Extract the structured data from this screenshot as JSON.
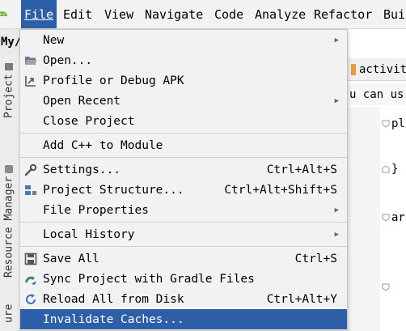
{
  "menubar": {
    "items": [
      {
        "label": "File"
      },
      {
        "label": "Edit"
      },
      {
        "label": "View"
      },
      {
        "label": "Navigate"
      },
      {
        "label": "Code"
      },
      {
        "label": "Analyze"
      },
      {
        "label": "Refactor"
      },
      {
        "label": "Bui"
      }
    ]
  },
  "project_label": "My/",
  "left_tabs": {
    "project": "Project",
    "resource_manager": "Resource Manager",
    "structure": "ure"
  },
  "editor": {
    "tab_label": "activity",
    "info_text": "u can us",
    "lines": [
      "pl",
      "}",
      "ar"
    ]
  },
  "file_menu": {
    "new": "New",
    "open": "Open...",
    "profile_debug": "Profile or Debug APK",
    "open_recent": "Open Recent",
    "close_project": "Close Project",
    "add_cpp": "Add C++ to Module",
    "settings": "Settings...",
    "settings_shortcut": "Ctrl+Alt+S",
    "project_structure": "Project Structure...",
    "project_structure_shortcut": "Ctrl+Alt+Shift+S",
    "file_properties": "File Properties",
    "local_history": "Local History",
    "save_all": "Save All",
    "save_all_shortcut": "Ctrl+S",
    "sync_gradle": "Sync Project with Gradle Files",
    "reload_disk": "Reload All from Disk",
    "reload_disk_shortcut": "Ctrl+Alt+Y",
    "invalidate_caches": "Invalidate Caches..."
  },
  "colors": {
    "highlight": "#2c5fa8",
    "menu_bg": "#f2f2f2"
  }
}
